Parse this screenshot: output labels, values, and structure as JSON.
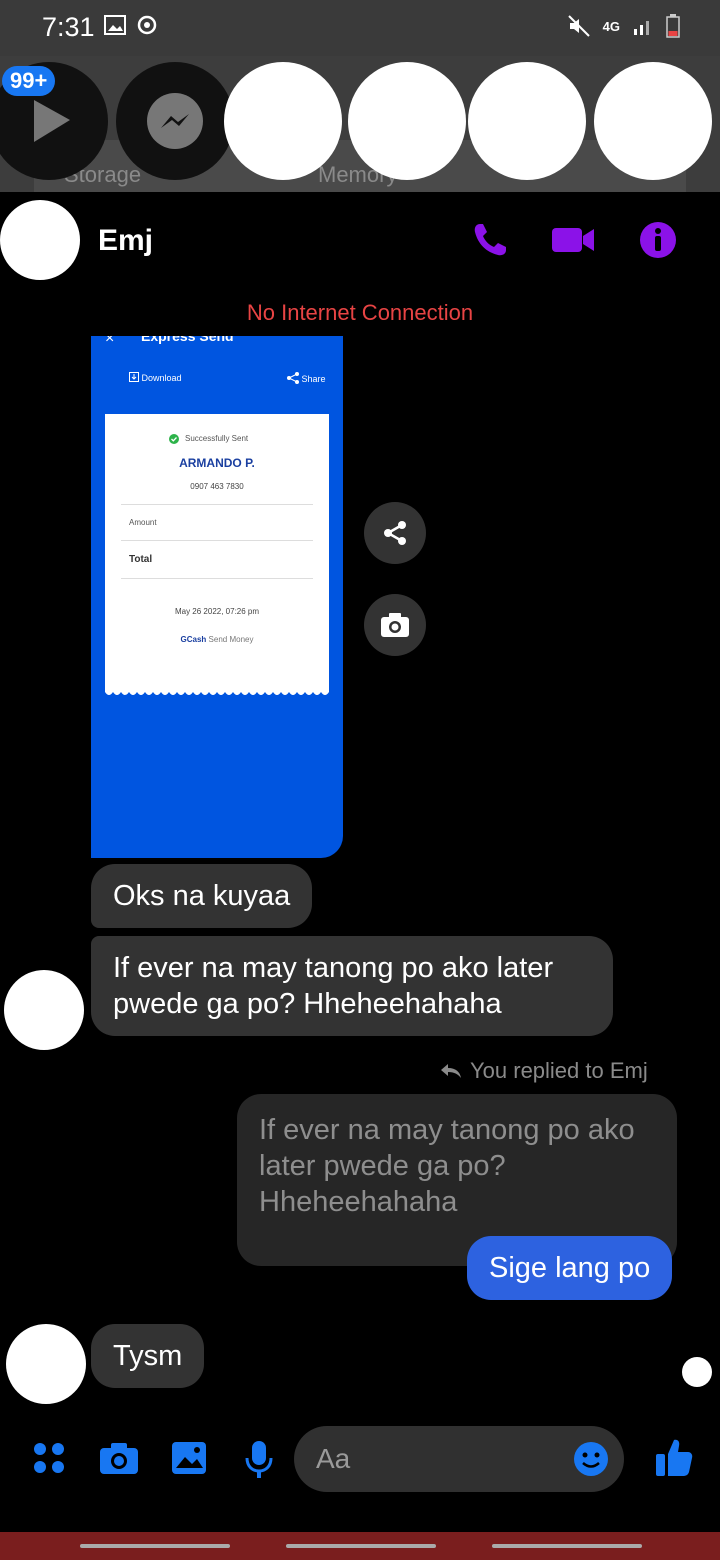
{
  "statusbar": {
    "time": "7:31",
    "network": "4G"
  },
  "chatheads": {
    "badge": "99+"
  },
  "background": {
    "word_left": "Storage",
    "word_right": "Memory"
  },
  "header": {
    "contact_name": "Emj"
  },
  "banner": {
    "no_internet": "No Internet Connection"
  },
  "receipt": {
    "title": "Express Send",
    "download": "Download",
    "share": "Share",
    "status": "Successfully Sent",
    "recipient": "ARMANDO P.",
    "number": "0907 463 7830",
    "amount_label": "Amount",
    "total_label": "Total",
    "date": "May 26 2022, 07:26 pm",
    "brand": "GCash",
    "brand_suffix": "Send Money"
  },
  "messages": {
    "m1": "Oks na kuyaa",
    "m2": "If ever na may tanong po ako later pwede ga po? Hheheehahaha",
    "reply_label": "You replied to Emj",
    "reply_quote": "If ever na may tanong po ako later pwede ga po? Hheheehahaha",
    "m3": "Sige lang po",
    "m4": "Tysm"
  },
  "composer": {
    "placeholder": "Aa"
  },
  "colors": {
    "accent_purple": "#8b12e8",
    "messenger_blue": "#1877f2",
    "outgoing_bubble": "#2d62e0",
    "incoming_bubble": "#333333",
    "error_red": "#e84444"
  }
}
